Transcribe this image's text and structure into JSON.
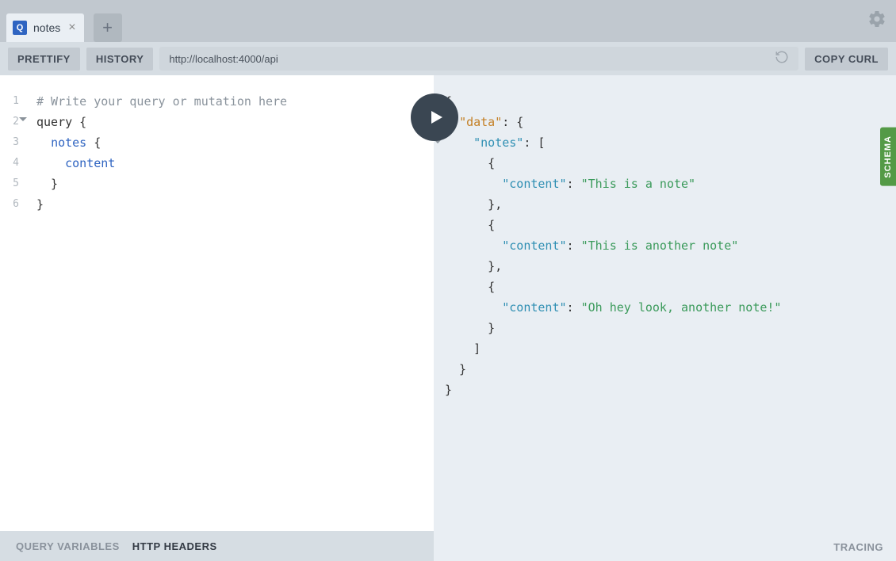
{
  "tabs": {
    "active": {
      "badge": "Q",
      "label": "notes"
    }
  },
  "toolbar": {
    "prettify": "PRETTIFY",
    "history": "HISTORY",
    "url": "http://localhost:4000/api",
    "copy_curl": "COPY CURL"
  },
  "editor": {
    "lines": [
      {
        "n": "1",
        "type": "comment",
        "text": "# Write your query or mutation here"
      },
      {
        "n": "2",
        "type": "code",
        "text_keyword": "query",
        "text_rest": " {"
      },
      {
        "n": "3",
        "type": "code",
        "indent": "  ",
        "field": "notes",
        "rest": " {"
      },
      {
        "n": "4",
        "type": "code",
        "indent": "    ",
        "field": "content",
        "rest": ""
      },
      {
        "n": "5",
        "type": "plain",
        "text": "  }"
      },
      {
        "n": "6",
        "type": "plain",
        "text": "}"
      }
    ]
  },
  "result": {
    "key_data": "\"data\"",
    "key_notes": "\"notes\"",
    "key_content": "\"content\"",
    "notes_values": [
      "\"This is a note\"",
      "\"This is another note\"",
      "\"Oh hey look, another note!\""
    ]
  },
  "bottom": {
    "query_vars": "QUERY VARIABLES",
    "http_headers": "HTTP HEADERS",
    "tracing": "TRACING"
  },
  "schema_label": "SCHEMA",
  "chart_data": {
    "type": "table",
    "title": "GraphQL query result: notes",
    "columns": [
      "content"
    ],
    "rows": [
      [
        "This is a note"
      ],
      [
        "This is another note"
      ],
      [
        "Oh hey look, another note!"
      ]
    ]
  }
}
